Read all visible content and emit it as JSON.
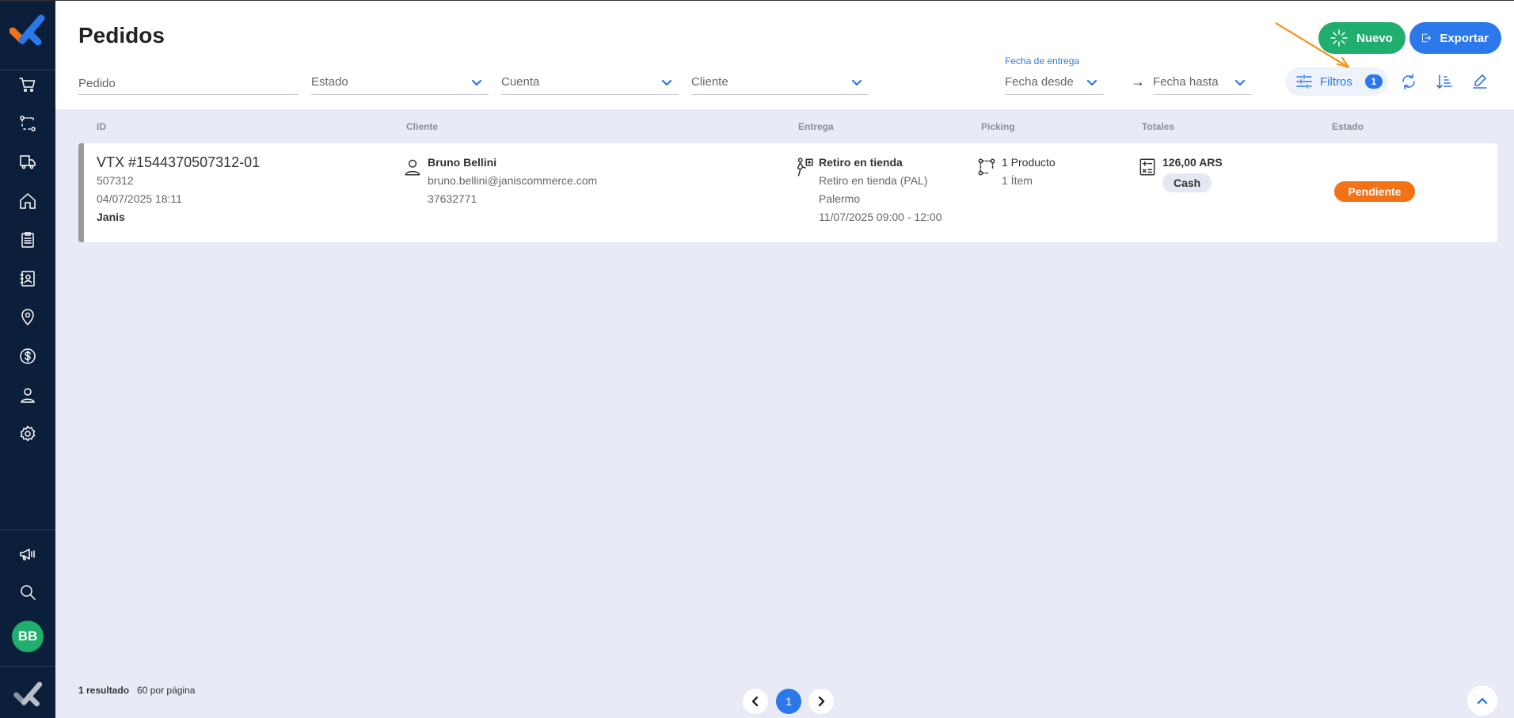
{
  "app": {
    "accent": "#2b78ea",
    "success": "#1fae6d",
    "warning": "#f47216",
    "sidebar_bg": "#0c1f3a"
  },
  "sidebar": {
    "items": [
      {
        "icon": "cart-icon"
      },
      {
        "icon": "route-icon"
      },
      {
        "icon": "delivery-truck-icon"
      },
      {
        "icon": "home-icon"
      },
      {
        "icon": "clipboard-icon"
      },
      {
        "icon": "contacts-icon"
      },
      {
        "icon": "location-pin-icon"
      },
      {
        "icon": "dollar-icon"
      },
      {
        "icon": "user-icon"
      },
      {
        "icon": "gear-icon"
      }
    ],
    "bottom_items": [
      {
        "icon": "megaphone-icon"
      },
      {
        "icon": "search-icon"
      }
    ],
    "avatar_initials": "BB"
  },
  "header": {
    "title": "Pedidos",
    "nuevo_label": "Nuevo",
    "exportar_label": "Exportar"
  },
  "filters": {
    "pedido_placeholder": "Pedido",
    "estado_placeholder": "Estado",
    "cuenta_placeholder": "Cuenta",
    "cliente_placeholder": "Cliente",
    "fecha_label": "Fecha de entrega",
    "fecha_desde": "Fecha desde",
    "fecha_hasta": "Fecha hasta",
    "filtros_label": "Filtros",
    "filtros_count": "1"
  },
  "table": {
    "columns": [
      "ID",
      "Cliente",
      "Entrega",
      "Picking",
      "Totales",
      "Estado"
    ],
    "rows": [
      {
        "id": "VTX #1544370507312-01",
        "sequence": "507312",
        "date": "04/07/2025 18:11",
        "account": "Janis",
        "client_name": "Bruno Bellini",
        "client_email": "bruno.bellini@janiscommerce.com",
        "client_doc": "37632771",
        "delivery_type": "Retiro en tienda",
        "delivery_store": "Retiro en tienda (PAL)",
        "delivery_area": "Palermo",
        "delivery_window": "11/07/2025 09:00 - 12:00",
        "picking_products": "1 Producto",
        "picking_items": "1 Ítem",
        "total": "126,00 ARS",
        "payment": "Cash",
        "status": "Pendiente"
      }
    ]
  },
  "footer": {
    "result_count": "1 resultado",
    "per_page": "60 por página",
    "current_page": "1"
  }
}
